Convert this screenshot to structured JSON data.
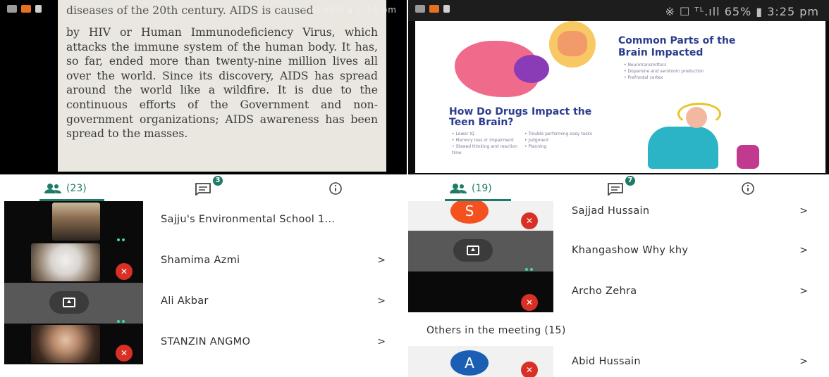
{
  "left": {
    "status": {
      "right": "※ ☐ ᵀᴸ.ıll 68% ▮ 2:14 pm"
    },
    "document": {
      "top_line": "diseases of the 20th century. AIDS is caused",
      "text": "by HIV or Human Immunodeficiency Virus, which attacks the immune system of the human body. It has, so far, ended more than twenty-nine million lives all over the world. Since its discovery, AIDS has spread around the world like a wildfire. It is due to the continuous efforts of the Government and non-government organizations; AIDS awareness has been spread to the masses."
    },
    "tabs": {
      "people_count": "(23)",
      "chat_badge": "3",
      "people_icon": "people-icon",
      "chat_icon": "chat-icon",
      "info_icon": "info-icon"
    },
    "participants": [
      {
        "name": "Sajju's Environmental School 1...",
        "chevron": ""
      },
      {
        "name": "Shamima Azmi",
        "chevron": ">"
      },
      {
        "name": "Ali Akbar",
        "chevron": ">"
      },
      {
        "name": "STANZIN ANGMO",
        "chevron": ">"
      }
    ]
  },
  "right": {
    "status": {
      "right": "※ ☐ ᵀᴸ.ıll 65% ▮ 3:25 pm"
    },
    "slide": {
      "heading1": "Common Parts of the Brain Impacted",
      "bullets1": [
        "• Neurotransmitters",
        "• Dopamine and serotonin production",
        "• Prefrontal cortex"
      ],
      "heading2": "How Do Drugs Impact the Teen Brain?",
      "bullets2": [
        "• Lower IQ",
        "• Memory loss or impairment",
        "• Slowed thinking and reaction time",
        "• Trouble performing easy tasks",
        "• Judgment",
        "• Planning"
      ]
    },
    "tabs": {
      "people_count": "(19)",
      "chat_badge": "7"
    },
    "participants": [
      {
        "name": "Sajjad Hussain",
        "chevron": ">",
        "initial": "S"
      },
      {
        "name": "Khangashow Why khy",
        "chevron": ">"
      },
      {
        "name": "Archo Zehra",
        "chevron": ">"
      }
    ],
    "others_heading": "Others in the meeting (15)",
    "others": [
      {
        "name": "Abid Hussain",
        "chevron": ">",
        "initial": "A"
      }
    ]
  },
  "colors": {
    "accent": "#1e7b68",
    "mute_red": "#d93025",
    "avatar_orange": "#f4511e",
    "avatar_blue": "#1a5fb4"
  }
}
